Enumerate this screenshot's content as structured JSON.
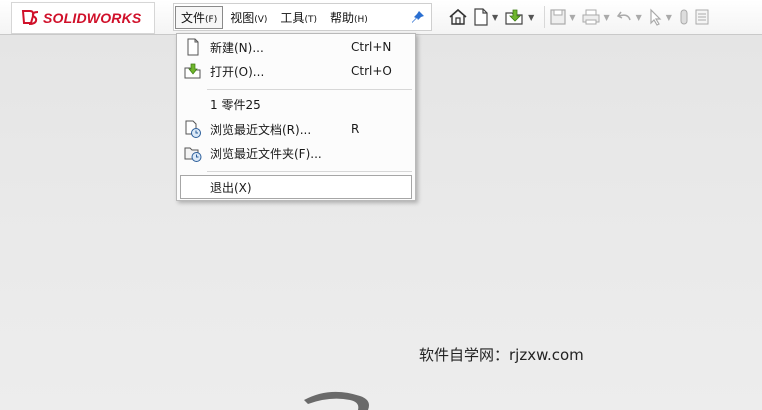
{
  "app": {
    "logo_text": "SOLIDWORKS"
  },
  "menubar": {
    "items": [
      {
        "label": "文件",
        "key": "(F)"
      },
      {
        "label": "视图",
        "key": "(V)"
      },
      {
        "label": "工具",
        "key": "(T)"
      },
      {
        "label": "帮助",
        "key": "(H)"
      }
    ]
  },
  "toolbar": {
    "icons": [
      "home-icon",
      "new-document-icon",
      "open-icon",
      "save-icon",
      "print-icon",
      "undo-icon",
      "select-icon",
      "rebuild-icon",
      "options-icon"
    ]
  },
  "file_menu": {
    "items": [
      {
        "label": "新建(N)...",
        "shortcut": "Ctrl+N"
      },
      {
        "label": "打开(O)...",
        "shortcut": "Ctrl+O"
      },
      {
        "label": "1 零件25",
        "shortcut": ""
      },
      {
        "label": "浏览最近文档(R)...",
        "shortcut": "R"
      },
      {
        "label": "浏览最近文件夹(F)...",
        "shortcut": ""
      },
      {
        "label": "退出(X)",
        "shortcut": ""
      }
    ]
  },
  "watermark": {
    "text": "软件自学网：rjzxw.com"
  },
  "colors": {
    "brand": "#d0102a",
    "pin": "#2a6fd1"
  }
}
